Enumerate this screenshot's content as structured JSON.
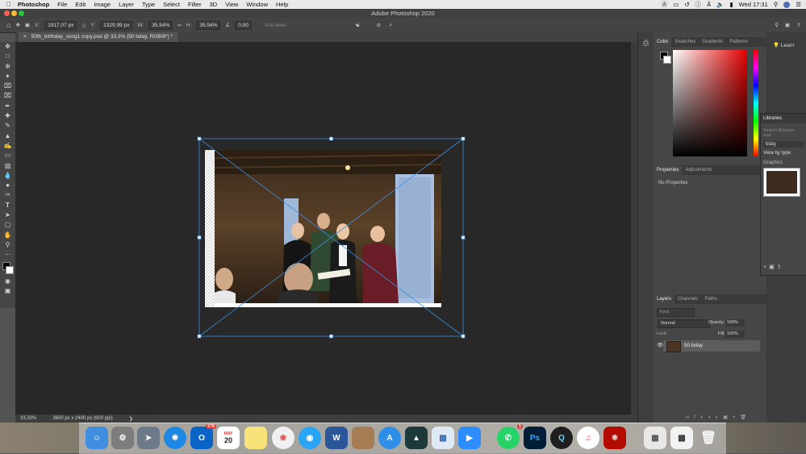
{
  "menubar": {
    "app": "Photoshop",
    "items": [
      "File",
      "Edit",
      "Image",
      "Layer",
      "Type",
      "Select",
      "Filter",
      "3D",
      "View",
      "Window",
      "Help"
    ],
    "clock": "Wed 17:31"
  },
  "window": {
    "title": "Adobe Photoshop 2020"
  },
  "options_bar": {
    "x_label": "X:",
    "x_value": "1917,07 px",
    "y_label": "Y:",
    "y_value": "1329,99 px",
    "w_label": "W:",
    "w_value": "35,54%",
    "h_label": "H:",
    "h_value": "35,54%",
    "angle_value": "0,00",
    "antialias_label": "Anti-alias"
  },
  "document": {
    "tab_label": "50th_birthday_song1 copy.psd @ 33,3% (50 bday, RGB/8*) *"
  },
  "status": {
    "zoom": "33,33%",
    "doc_info": "3600 px x 2400 px (600 ppi)"
  },
  "color_panel": {
    "tabs": [
      "Color",
      "Swatches",
      "Gradients",
      "Patterns"
    ]
  },
  "properties_panel": {
    "tabs": [
      "Properties",
      "Adjustments"
    ],
    "empty_text": "No Properties"
  },
  "layers_panel": {
    "tabs": [
      "Layers",
      "Channels",
      "Paths"
    ],
    "filter_placeholder": "Kind",
    "blend_mode": "Normal",
    "opacity_label": "Opacity:",
    "opacity_value": "100%",
    "lock_label": "Lock:",
    "fill_label": "Fill:",
    "fill_value": "100%",
    "layers": [
      {
        "name": "50 bday"
      }
    ]
  },
  "learn_panel": {
    "label": "Learn"
  },
  "libraries_panel": {
    "title": "Libraries",
    "search_placeholder": "Search libraries and...",
    "library_name": "bday",
    "view_by": "View by type",
    "section": "Graphics"
  },
  "dock": {
    "outlook_badge": "278",
    "calendar_month": "MAY",
    "calendar_day": "20",
    "whatsapp_badge": "1"
  }
}
